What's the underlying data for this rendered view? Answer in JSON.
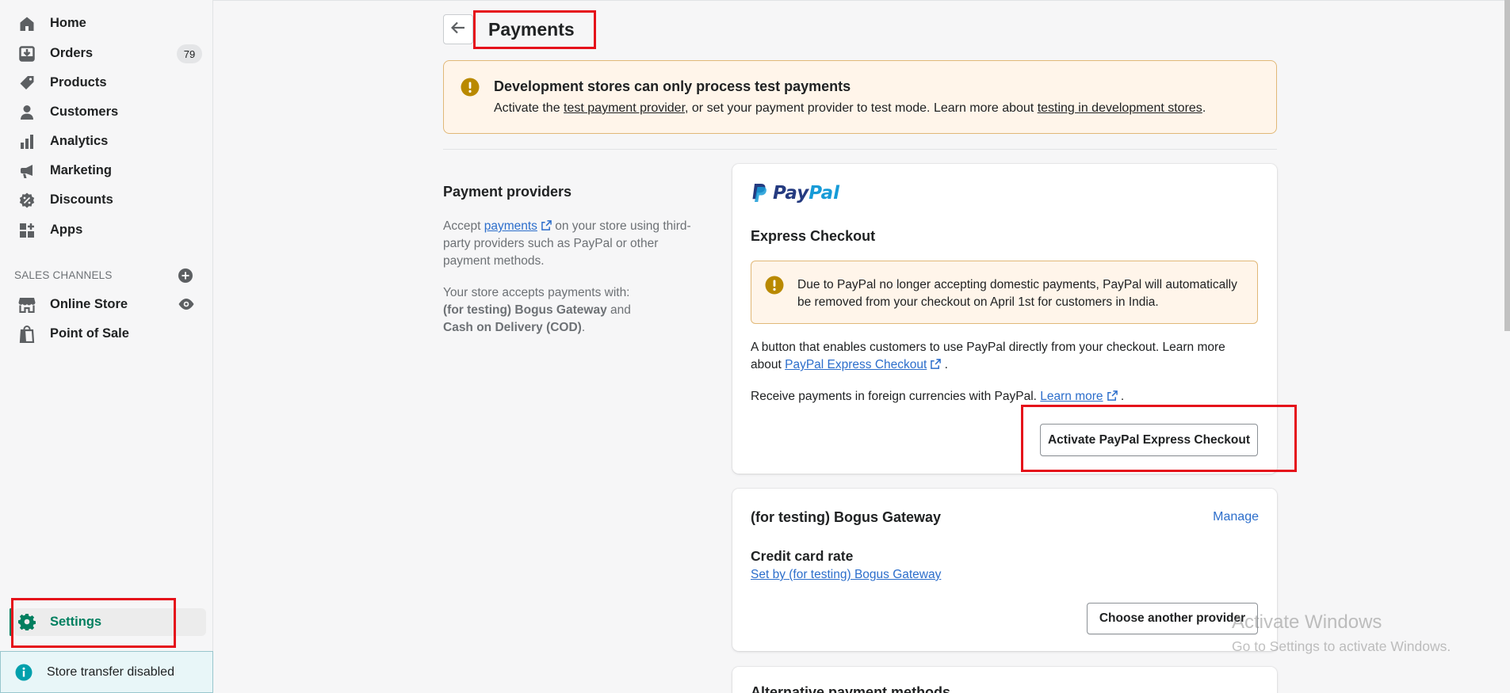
{
  "sidebar": {
    "items": [
      {
        "label": "Home",
        "icon": "home-icon"
      },
      {
        "label": "Orders",
        "icon": "orders-icon",
        "badge": "79"
      },
      {
        "label": "Products",
        "icon": "tag-icon"
      },
      {
        "label": "Customers",
        "icon": "person-icon"
      },
      {
        "label": "Analytics",
        "icon": "bar-chart-icon"
      },
      {
        "label": "Marketing",
        "icon": "megaphone-icon"
      },
      {
        "label": "Discounts",
        "icon": "discount-icon"
      },
      {
        "label": "Apps",
        "icon": "apps-icon"
      }
    ],
    "sales_channels_header": "SALES CHANNELS",
    "channels": [
      {
        "label": "Online Store",
        "icon": "store-icon"
      },
      {
        "label": "Point of Sale",
        "icon": "shopping-bag-icon"
      }
    ],
    "settings_label": "Settings",
    "store_transfer": "Store transfer disabled"
  },
  "header": {
    "title": "Payments"
  },
  "banner": {
    "title": "Development stores can only process test payments",
    "body_prefix": "Activate the ",
    "link1": "test payment provider",
    "body_middle": ", or set your payment provider to test mode. Learn more about ",
    "link2": "testing in development stores",
    "body_suffix": "."
  },
  "providers_section": {
    "title": "Payment providers",
    "desc_prefix": "Accept ",
    "desc_link": "payments",
    "desc_suffix": " on your store using third-party providers such as PayPal or other payment methods.",
    "accepts_prefix": "Your store accepts payments with:",
    "accepts_1": "(for testing) Bogus Gateway",
    "accepts_and": " and",
    "accepts_2": "Cash on Delivery (COD)",
    "accepts_end": "."
  },
  "paypal_card": {
    "logo_text_dark": "Pay",
    "logo_text_light": "Pal",
    "title": "Express Checkout",
    "warning": "Due to PayPal no longer accepting domestic payments, PayPal will automatically be removed from your checkout on April 1st for customers in India.",
    "desc_prefix": "A button that enables customers to use PayPal directly from your checkout. Learn more about ",
    "desc_link": "PayPal Express Checkout",
    "desc_suffix": " .",
    "fx_prefix": "Receive payments in foreign currencies with PayPal. ",
    "fx_link": "Learn more",
    "fx_suffix": " .",
    "button": "Activate PayPal Express Checkout"
  },
  "bogus_card": {
    "title": "(for testing) Bogus Gateway",
    "manage": "Manage",
    "rate_title": "Credit card rate",
    "rate_link": "Set by (for testing) Bogus Gateway",
    "button": "Choose another provider"
  },
  "alt_card": {
    "title": "Alternative payment methods"
  },
  "watermark": {
    "line1": "Activate Windows",
    "line2": "Go to Settings to activate Windows."
  },
  "colors": {
    "accent": "#008060",
    "link": "#2c6ecb",
    "highlight": "#e5101a",
    "warning_bg": "#fff5ea",
    "warning_icon": "#b98900"
  }
}
